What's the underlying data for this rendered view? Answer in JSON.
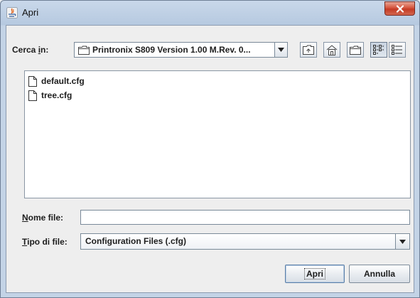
{
  "window": {
    "title": "Apri"
  },
  "look_in": {
    "label_prefix": "Cerca ",
    "label_mnemonic": "i",
    "label_suffix": "n:",
    "value": "Printronix S809 Version  1.00 M.Rev. 0..."
  },
  "toolbar": {
    "icons": [
      "up-one-level-icon",
      "home-icon",
      "new-folder-icon",
      "list-view-icon",
      "details-view-icon"
    ]
  },
  "files": [
    {
      "name": "default.cfg"
    },
    {
      "name": "tree.cfg"
    }
  ],
  "file_name": {
    "label_mnemonic": "N",
    "label_rest": "ome file:",
    "value": ""
  },
  "file_type": {
    "label_mnemonic": "T",
    "label_rest": "ipo di file:",
    "value": "Configuration Files (.cfg)"
  },
  "buttons": {
    "open": "Apri",
    "cancel": "Annulla"
  },
  "colors": {
    "title_close": "#c43b24",
    "client_bg": "#eeeeee",
    "frame": "#c3d3e6"
  }
}
